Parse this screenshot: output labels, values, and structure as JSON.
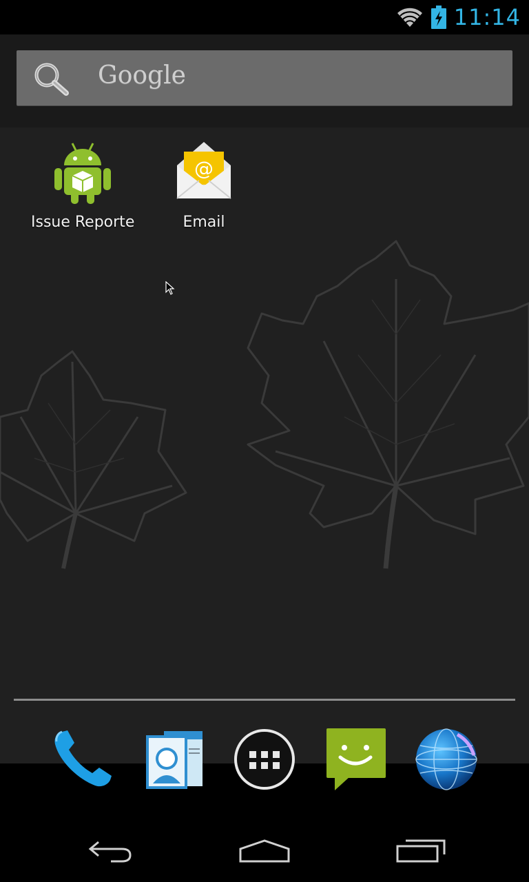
{
  "status_bar": {
    "time": "11:14",
    "icons": [
      "wifi-icon",
      "battery-charging-icon"
    ],
    "accent_color": "#33b5e5"
  },
  "search": {
    "label": "Google",
    "icon": "search-icon"
  },
  "home_apps": [
    {
      "label": "Issue Reporte",
      "icon": "android-box-icon"
    },
    {
      "label": "Email",
      "icon": "email-envelope-icon"
    }
  ],
  "dock": [
    {
      "icon": "phone-icon"
    },
    {
      "icon": "contacts-icon"
    },
    {
      "icon": "all-apps-icon"
    },
    {
      "icon": "messaging-icon"
    },
    {
      "icon": "browser-globe-icon"
    }
  ],
  "nav_bar": [
    {
      "icon": "back-icon"
    },
    {
      "icon": "home-icon"
    },
    {
      "icon": "recent-apps-icon"
    }
  ],
  "colors": {
    "background": "#202020",
    "status_bar": "#000000",
    "search_bar": "#6b6b6b",
    "android_green": "#8fbf2e",
    "email_yellow": "#f5c400"
  }
}
